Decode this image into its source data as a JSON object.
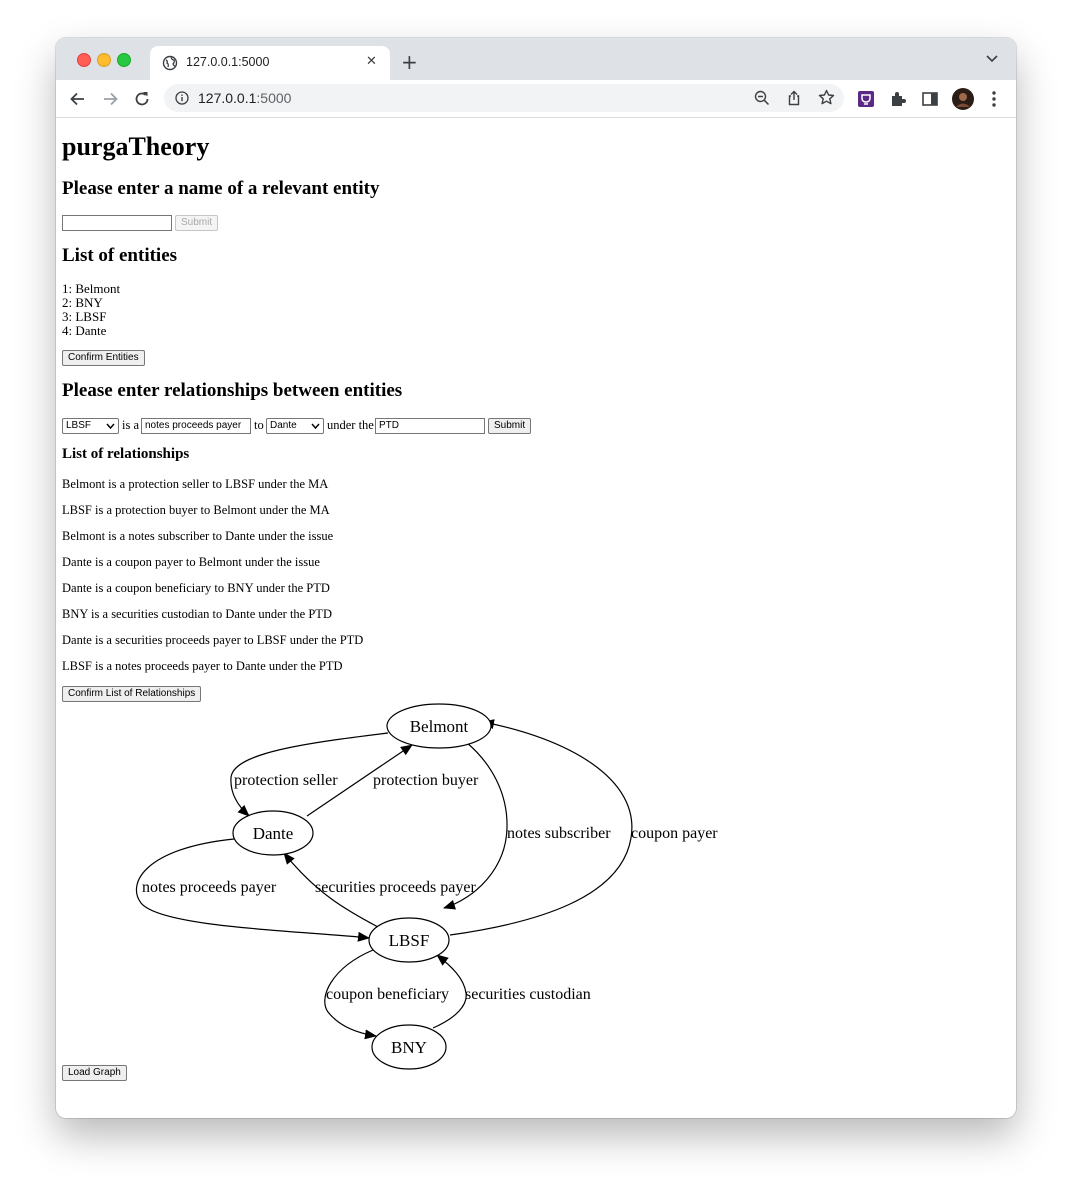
{
  "browser": {
    "tab_title": "127.0.0.1:5000",
    "url_host": "127.0.0.1",
    "url_port": ":5000"
  },
  "page": {
    "title": "purgaTheory",
    "entity_heading": "Please enter a name of a relevant entity",
    "entity_input_value": "",
    "entity_submit": "Submit",
    "entities_heading": "List of entities",
    "entities": [
      "1: Belmont",
      "2: BNY",
      "3: LBSF",
      "4: Dante"
    ],
    "confirm_entities": "Confirm Entities",
    "relationships_heading": "Please enter relationships between entities",
    "form": {
      "from_entity": "LBSF",
      "is_a": "is a",
      "role": "notes proceeds payer",
      "to": "to",
      "to_entity": "Dante",
      "under_the": "under the",
      "agreement": "PTD",
      "submit": "Submit"
    },
    "relationships_list_heading": "List of relationships",
    "relationships": [
      "Belmont is a protection seller to LBSF under the MA",
      "LBSF is a protection buyer to Belmont under the MA",
      "Belmont is a notes subscriber to Dante under the issue",
      "Dante is a coupon payer to Belmont under the issue",
      "Dante is a coupon beneficiary to BNY under the PTD",
      "BNY is a securities custodian to Dante under the PTD",
      "Dante is a securities proceeds payer to LBSF under the PTD",
      "LBSF is a notes proceeds payer to Dante under the PTD"
    ],
    "confirm_relationships": "Confirm List of Relationships",
    "load_graph": "Load Graph"
  },
  "graph": {
    "nodes": [
      "Belmont",
      "LBSF",
      "Dante",
      "BNY"
    ],
    "edge_labels": {
      "protection_seller": "protection seller",
      "protection_buyer": "protection buyer",
      "notes_subscriber": "notes subscriber",
      "coupon_payer": "coupon payer",
      "notes_proceeds_payer": "notes proceeds payer",
      "securities_proceeds_payer": "securities proceeds payer",
      "coupon_beneficiary": "coupon beneficiary",
      "securities_custodian": "securities custodian"
    }
  }
}
